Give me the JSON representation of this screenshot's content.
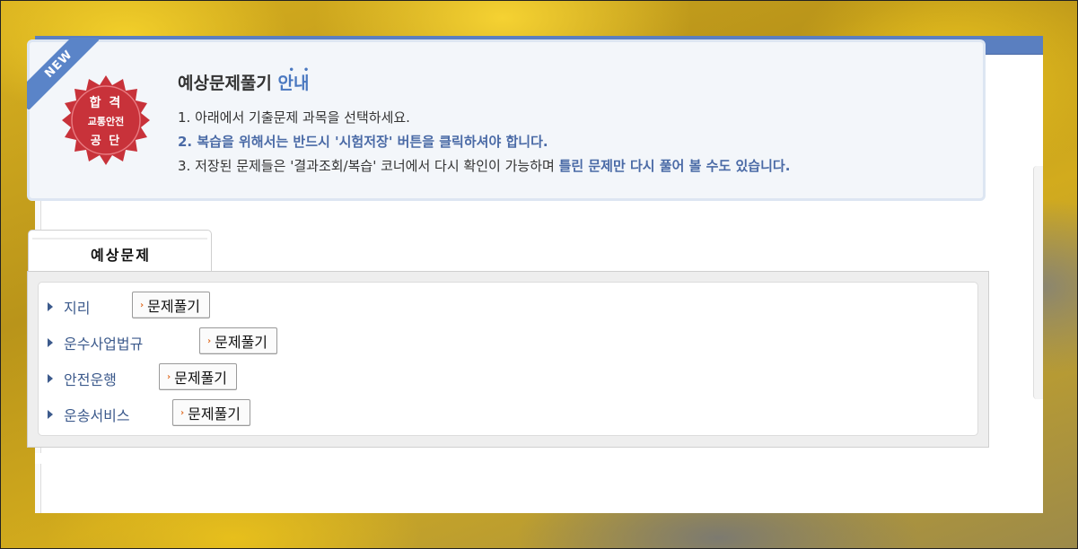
{
  "info": {
    "badge_new": "NEW",
    "seal": {
      "line1": "합 격",
      "line2": "교통안전",
      "line3": "공 단"
    },
    "title_main": "예상문제풀기 ",
    "title_accent": "안내",
    "line1": "1. 아래에서 기출문제 과목을 선택하세요.",
    "line2": "2. 복습을 위해서는 반드시 '시험저장' 버튼을 클릭하셔야 합니다.",
    "line3_plain": "3. 저장된 문제들은 '결과조회/복습' 코너에서 다시 확인이 가능하며 ",
    "line3_bold": "틀린 문제만 다시 풀어 볼 수도 있습니다."
  },
  "tab": {
    "label": "예상문제"
  },
  "subjects": [
    {
      "name": "지리",
      "button": "문제풀기"
    },
    {
      "name": "운수사업법규",
      "button": "문제풀기"
    },
    {
      "name": "안전운행",
      "button": "문제풀기"
    },
    {
      "name": "운송서비스",
      "button": "문제풀기"
    }
  ],
  "colors": {
    "topbar": "#5a7fc0",
    "accent_blue": "#4a78c0",
    "seal_red": "#c8323a",
    "subject_text": "#3c5a8c"
  }
}
